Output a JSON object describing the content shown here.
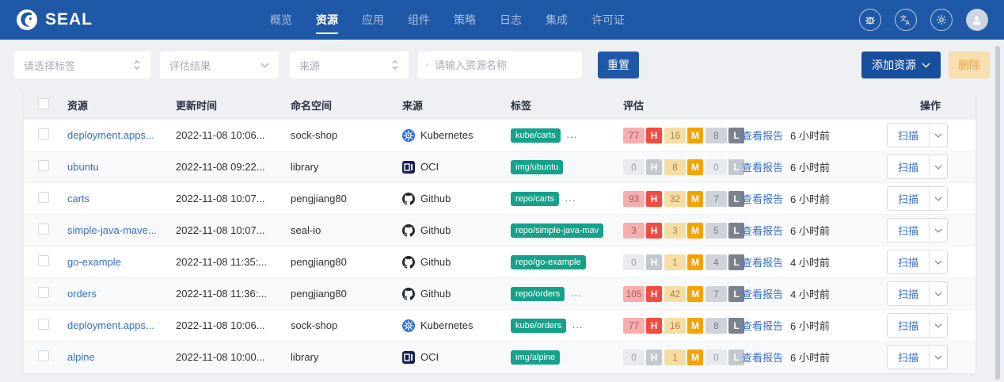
{
  "brand": {
    "name": "SEAL"
  },
  "nav": {
    "items": [
      {
        "label": "概览",
        "active": false
      },
      {
        "label": "资源",
        "active": true
      },
      {
        "label": "应用",
        "active": false
      },
      {
        "label": "组件",
        "active": false
      },
      {
        "label": "策略",
        "active": false
      },
      {
        "label": "日志",
        "active": false
      },
      {
        "label": "集成",
        "active": false
      },
      {
        "label": "许可证",
        "active": false
      }
    ]
  },
  "filters": {
    "tag_select_placeholder": "请选择标签",
    "result_select_placeholder": "评估结果",
    "source_select_placeholder": "来源",
    "search_placeholder": "请输入资源名称",
    "reset_label": "重置",
    "add_resource_label": "添加资源",
    "delete_label": "删除"
  },
  "table": {
    "columns": [
      "资源",
      "更新时间",
      "命名空间",
      "来源",
      "标签",
      "评估",
      "操作"
    ],
    "severity_labels": {
      "high": "H",
      "medium": "M",
      "low": "L"
    },
    "report_label": "查看报告",
    "scan_label": "扫描",
    "rows": [
      {
        "name": "deployment.apps...",
        "updated": "2022-11-08 10:06...",
        "namespace": "sock-shop",
        "source": "Kubernetes",
        "source_icon": "kubernetes",
        "tag": "kube/carts",
        "tag_more": true,
        "high": 77,
        "medium": 16,
        "low": 8,
        "time": "6 小时前"
      },
      {
        "name": "ubuntu",
        "updated": "2022-11-08 09:22...",
        "namespace": "library",
        "source": "OCI",
        "source_icon": "oci",
        "tag": "img/ubuntu",
        "tag_more": false,
        "high": 0,
        "medium": 8,
        "low": 0,
        "time": "6 小时前"
      },
      {
        "name": "carts",
        "updated": "2022-11-08 10:07...",
        "namespace": "pengjiang80",
        "source": "Github",
        "source_icon": "github",
        "tag": "repo/carts",
        "tag_more": true,
        "high": 93,
        "medium": 32,
        "low": 7,
        "time": "6 小时前"
      },
      {
        "name": "simple-java-mave...",
        "updated": "2022-11-08 10:07...",
        "namespace": "seal-io",
        "source": "Github",
        "source_icon": "github",
        "tag": "repo/simple-java-mav",
        "tag_more": false,
        "high": 3,
        "medium": 3,
        "low": 5,
        "time": "6 小时前"
      },
      {
        "name": "go-example",
        "updated": "2022-11-08 11:35:...",
        "namespace": "pengjiang80",
        "source": "Github",
        "source_icon": "github",
        "tag": "repo/go-example",
        "tag_more": false,
        "high": 0,
        "medium": 1,
        "low": 4,
        "time": "4 小时前"
      },
      {
        "name": "orders",
        "updated": "2022-11-08 11:36:...",
        "namespace": "pengjiang80",
        "source": "Github",
        "source_icon": "github",
        "tag": "repo/orders",
        "tag_more": true,
        "high": 105,
        "medium": 42,
        "low": 7,
        "time": "4 小时前"
      },
      {
        "name": "deployment.apps...",
        "updated": "2022-11-08 10:06...",
        "namespace": "sock-shop",
        "source": "Kubernetes",
        "source_icon": "kubernetes",
        "tag": "kube/orders",
        "tag_more": true,
        "high": 77,
        "medium": 16,
        "low": 8,
        "time": "6 小时前"
      },
      {
        "name": "alpine",
        "updated": "2022-11-08 10:00...",
        "namespace": "library",
        "source": "OCI",
        "source_icon": "oci",
        "tag": "img/alpine",
        "tag_more": false,
        "high": 0,
        "medium": 1,
        "low": 0,
        "time": "6 小时前"
      }
    ]
  },
  "colors": {
    "brand": "#1f58a6",
    "brand_dark": "#174f9e",
    "link": "#3a6fc8",
    "teal": "#16a28a",
    "sev_high": "#f24b40",
    "sev_med": "#f5a300",
    "sev_low": "#7a828f",
    "sev_zero": "#c3c8d0",
    "warn_bg": "#f8dfae",
    "warn_text": "#eba850"
  }
}
